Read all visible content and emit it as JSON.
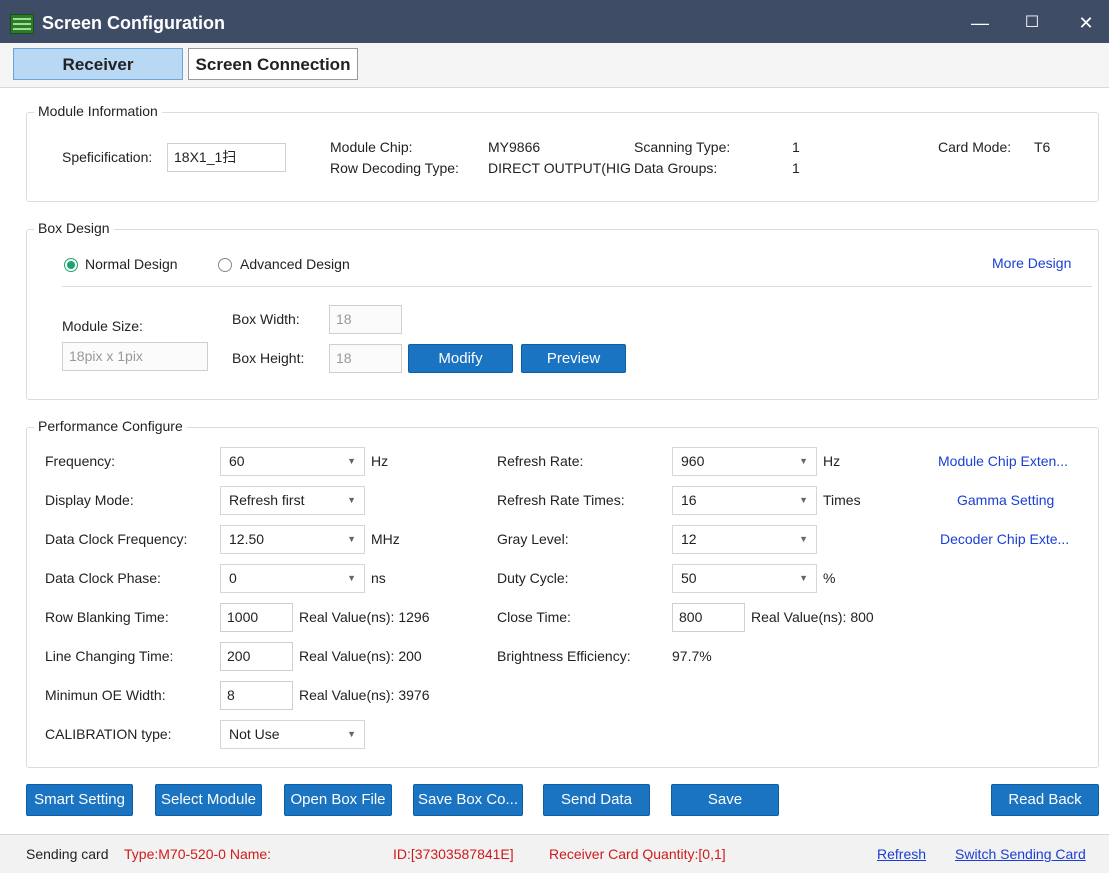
{
  "window": {
    "title": "Screen Configuration",
    "minimize": "—",
    "maximize": "☐",
    "close": "✕"
  },
  "tabs": [
    {
      "label": "Receiver"
    },
    {
      "label": "Screen Connection"
    }
  ],
  "module_info": {
    "legend": "Module Information",
    "spec_label": "Speficification:",
    "spec_value": "18X1_1扫",
    "chip_label": "Module Chip:",
    "chip_value": "MY9866",
    "row_decoding_label": "Row Decoding Type:",
    "row_decoding_value": "DIRECT OUTPUT(HIG",
    "scanning_label": "Scanning Type:",
    "scanning_value": "1",
    "data_groups_label": "Data Groups:",
    "data_groups_value": "1",
    "card_mode_label": "Card Mode:",
    "card_mode_value": "T6"
  },
  "box_design": {
    "legend": "Box Design",
    "normal_design": "Normal Design",
    "advanced_design": "Advanced Design",
    "more_design": "More Design",
    "module_size_label": "Module Size:",
    "module_size_value": "18pix x 1pix",
    "box_width_label": "Box Width:",
    "box_width_value": "18",
    "box_height_label": "Box Height:",
    "box_height_value": "18",
    "modify": "Modify",
    "preview": "Preview"
  },
  "performance": {
    "legend": "Performance Configure",
    "frequency_label": "Frequency:",
    "frequency_value": "60",
    "frequency_unit": "Hz",
    "display_mode_label": "Display Mode:",
    "display_mode_value": "Refresh first",
    "data_clock_freq_label": "Data Clock Frequency:",
    "data_clock_freq_value": "12.50",
    "data_clock_freq_unit": "MHz",
    "data_clock_phase_label": "Data Clock Phase:",
    "data_clock_phase_value": "0",
    "data_clock_phase_unit": "ns",
    "row_blanking_label": "Row Blanking Time:",
    "row_blanking_value": "1000",
    "row_blanking_real": "Real Value(ns): 1296",
    "line_changing_label": "Line Changing Time:",
    "line_changing_value": "200",
    "line_changing_real": "Real Value(ns): 200",
    "min_oe_label": "Minimun OE Width:",
    "min_oe_value": "8",
    "min_oe_real": "Real Value(ns): 3976",
    "calibration_label": "CALIBRATION type:",
    "calibration_value": "Not Use",
    "refresh_rate_label": "Refresh Rate:",
    "refresh_rate_value": "960",
    "refresh_rate_unit": "Hz",
    "refresh_times_label": "Refresh Rate Times:",
    "refresh_times_value": "16",
    "refresh_times_unit": "Times",
    "gray_level_label": "Gray Level:",
    "gray_level_value": "12",
    "duty_cycle_label": "Duty Cycle:",
    "duty_cycle_value": "50",
    "duty_cycle_unit": "%",
    "close_time_label": "Close Time:",
    "close_time_value": "800",
    "close_time_real": "Real Value(ns): 800",
    "brightness_label": "Brightness Efficiency:",
    "brightness_value": "97.7%",
    "module_chip_ext": "Module Chip Exten...",
    "gamma_setting": "Gamma Setting",
    "decoder_chip_ext": "Decoder Chip Exte..."
  },
  "actions": {
    "smart_setting": "Smart Setting",
    "select_module": "Select Module",
    "open_box_file": "Open Box File",
    "save_box_config": "Save Box Co...",
    "send_data": "Send Data",
    "save": "Save",
    "read_back": "Read Back"
  },
  "status": {
    "sending_card": "Sending card",
    "type": "Type:M70-520-0 Name:",
    "id": "ID:[37303587841E]",
    "receiver_qty": "Receiver Card Quantity:[0,1]",
    "refresh": "Refresh",
    "switch_sending": "Switch Sending Card"
  }
}
